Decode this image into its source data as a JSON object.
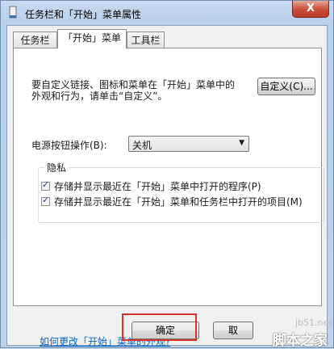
{
  "window": {
    "title": "任务栏和「开始」菜单属性",
    "close_label": "X"
  },
  "tabs": [
    {
      "label": "任务栏"
    },
    {
      "label": "「开始」菜单"
    },
    {
      "label": "工具栏"
    }
  ],
  "customize": {
    "description_line1": "要自定义链接、图标和菜单在「开始」菜单中的",
    "description_line2": "外观和行为，请单击“自定义”。",
    "button_label": "自定义(C)..."
  },
  "power": {
    "label": "电源按钮操作(B):",
    "selected": "关机"
  },
  "privacy": {
    "group_title": "隐私",
    "options": [
      {
        "label": "存储并显示最近在「开始」菜单中打开的程序(P)",
        "checked": true
      },
      {
        "label": "存储并显示最近在「开始」菜单和任务栏中打开的项目(M)",
        "checked": true
      }
    ]
  },
  "help_link": "如何更改「开始」菜单的外观?",
  "footer": {
    "ok_label": "确定",
    "cancel_label": "取"
  },
  "watermark": {
    "site": "jb51.net",
    "logo": "脚本之家"
  }
}
